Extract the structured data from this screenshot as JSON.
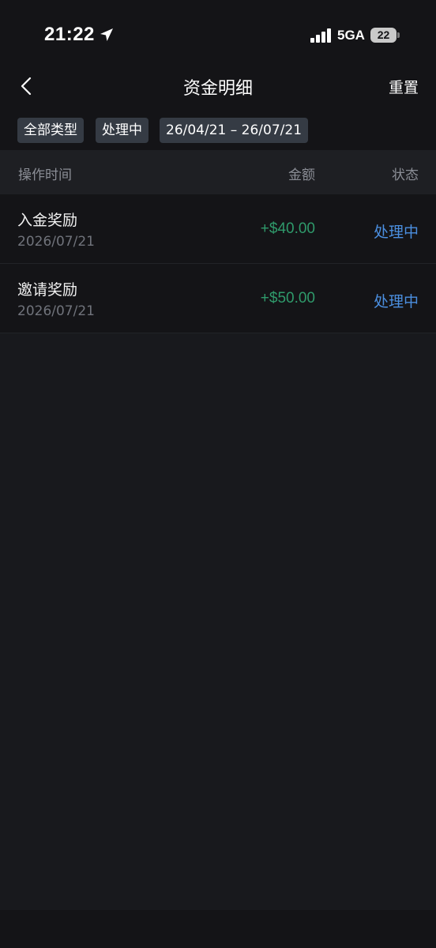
{
  "status_bar": {
    "time": "21:22",
    "network": "5GA",
    "battery": "22",
    "icons": [
      "location-arrow-icon",
      "signal-icon",
      "battery-icon"
    ]
  },
  "header": {
    "title": "资金明细",
    "reset_label": "重置",
    "back_icon": "chevron-left-icon"
  },
  "filters": {
    "type": "全部类型",
    "status": "处理中",
    "date_range": "26/04/21 – 26/07/21"
  },
  "table": {
    "columns": [
      "操作时间",
      "金额",
      "状态"
    ],
    "rows": [
      {
        "title": "入金奖励",
        "date": "2026/07/21",
        "amount": "+$40.00",
        "status": "处理中"
      },
      {
        "title": "邀请奖励",
        "date": "2026/07/21",
        "amount": "+$50.00",
        "status": "处理中"
      }
    ]
  },
  "colors": {
    "background": "#18191d",
    "amount_positive": "#2f9a6b",
    "status_processing": "#4b8fe0",
    "chip_bg": "#353b44"
  }
}
